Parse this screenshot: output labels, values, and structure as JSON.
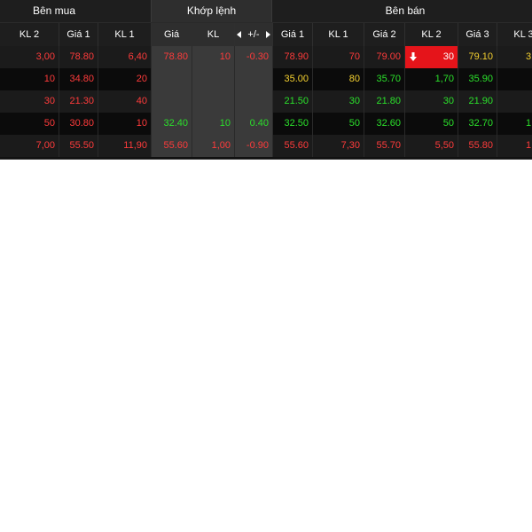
{
  "groups": {
    "buy": "Bên mua",
    "match": "Khớp lệnh",
    "sell": "Bên bán"
  },
  "columns": {
    "buy_kl2": "KL 2",
    "buy_gia1": "Giá 1",
    "buy_kl1": "KL 1",
    "match_gia": "Giá",
    "match_kl": "KL",
    "match_change": "+/-",
    "sell_gia1": "Giá 1",
    "sell_kl1": "KL 1",
    "sell_gia2": "Giá 2",
    "sell_kl2": "KL 2",
    "sell_gia3": "Giá 3",
    "sell_kl3": "KL 3"
  },
  "rows": [
    {
      "buy_kl2": "3,00",
      "buy_gia1": "78.80",
      "buy_kl1": "6,40",
      "match_gia": "78.80",
      "match_kl": "10",
      "match_change": "-0.30",
      "sell_gia1": "78.90",
      "sell_kl1": "70",
      "sell_gia2": "79.00",
      "sell_kl2": "30",
      "sell_gia3": "79.10",
      "sell_kl3": "3"
    },
    {
      "buy_kl2": "10",
      "buy_gia1": "34.80",
      "buy_kl1": "20",
      "match_gia": "",
      "match_kl": "",
      "match_change": "",
      "sell_gia1": "35.00",
      "sell_kl1": "80",
      "sell_gia2": "35.70",
      "sell_kl2": "1,70",
      "sell_gia3": "35.90",
      "sell_kl3": ""
    },
    {
      "buy_kl2": "30",
      "buy_gia1": "21.30",
      "buy_kl1": "40",
      "match_gia": "",
      "match_kl": "",
      "match_change": "",
      "sell_gia1": "21.50",
      "sell_kl1": "30",
      "sell_gia2": "21.80",
      "sell_kl2": "30",
      "sell_gia3": "21.90",
      "sell_kl3": ""
    },
    {
      "buy_kl2": "50",
      "buy_gia1": "30.80",
      "buy_kl1": "10",
      "match_gia": "32.40",
      "match_kl": "10",
      "match_change": "0.40",
      "sell_gia1": "32.50",
      "sell_kl1": "50",
      "sell_gia2": "32.60",
      "sell_kl2": "50",
      "sell_gia3": "32.70",
      "sell_kl3": "1"
    },
    {
      "buy_kl2": "7,00",
      "buy_gia1": "55.50",
      "buy_kl1": "11,90",
      "match_gia": "55.60",
      "match_kl": "1,00",
      "match_change": "-0.90",
      "sell_gia1": "55.60",
      "sell_kl1": "7,30",
      "sell_gia2": "55.70",
      "sell_kl2": "5,50",
      "sell_gia3": "55.80",
      "sell_kl3": "1"
    }
  ],
  "colors": {
    "up": "#2be02b",
    "down": "#ff3b3b",
    "ref": "#f5d130",
    "highlight": "#e5141a"
  },
  "icons": {
    "prev": "caret-left-icon",
    "next": "caret-right-icon",
    "flash": "arrow-down-icon"
  }
}
